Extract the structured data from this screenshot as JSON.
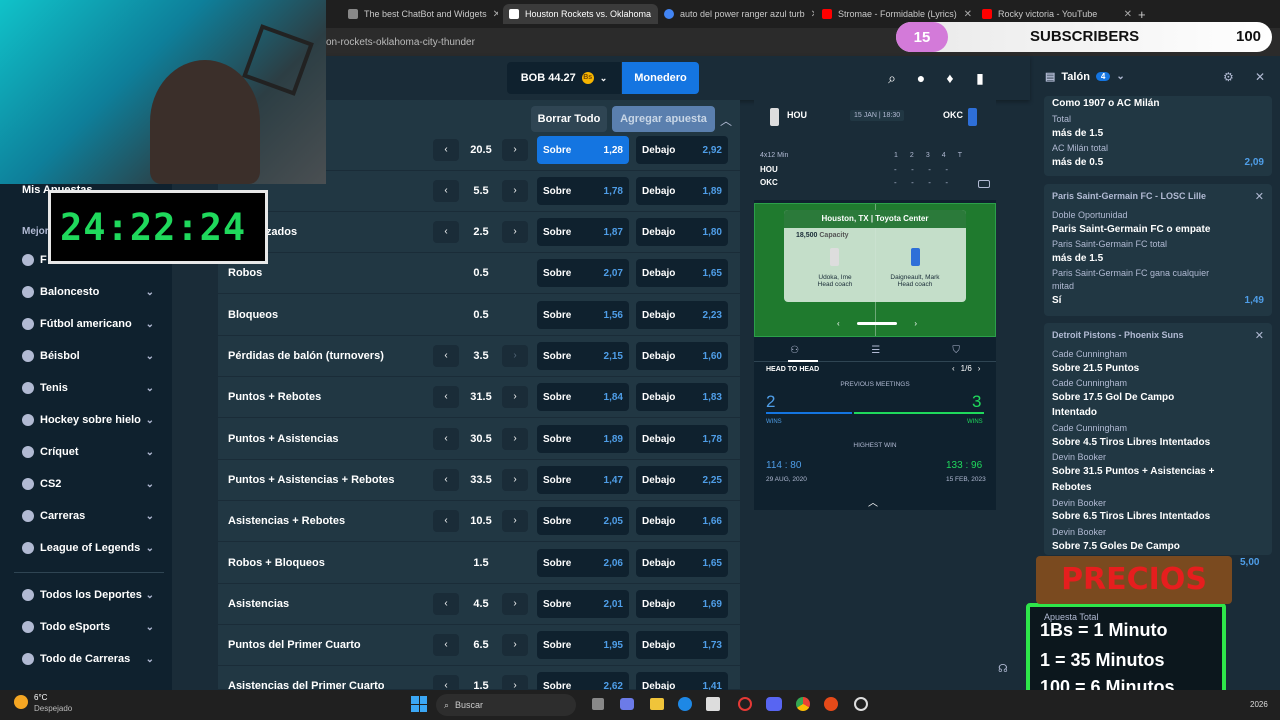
{
  "browser": {
    "tabs": [
      {
        "label": "The best ChatBot and Widgets"
      },
      {
        "label": "Houston Rockets vs. Oklahoma"
      },
      {
        "label": "auto del power ranger azul turb"
      },
      {
        "label": "Stromae - Formidable (Lyrics)"
      },
      {
        "label": "Rocky victoria - YouTube"
      }
    ],
    "url": "on-rockets-oklahoma-city-thunder"
  },
  "header": {
    "balance": "BOB 44.27",
    "wallet_label": "Monedero"
  },
  "sidebar": {
    "my_bets": "Mis Apuestas",
    "best_label": "Mejores D",
    "items": [
      {
        "label": "F"
      },
      {
        "label": "Baloncesto"
      },
      {
        "label": "Fútbol americano"
      },
      {
        "label": "Béisbol"
      },
      {
        "label": "Tenis"
      },
      {
        "label": "Hockey sobre hielo"
      },
      {
        "label": "Críquet"
      },
      {
        "label": "CS2"
      },
      {
        "label": "Carreras"
      },
      {
        "label": "League of Legends"
      },
      {
        "label": "Todos los Deportes"
      },
      {
        "label": "Todo eSports"
      },
      {
        "label": "Todo de Carreras"
      }
    ]
  },
  "betactions": {
    "clear": "Borrar Todo",
    "add": "Agregar apuesta"
  },
  "markets": [
    {
      "label": "",
      "line": "20.5",
      "over": "1,28",
      "under": "2,92",
      "arrows": true
    },
    {
      "label": "",
      "line": "5.5",
      "over": "1,78",
      "under": "1,89",
      "arrows": true
    },
    {
      "label": "es realizados",
      "line": "2.5",
      "over": "1,87",
      "under": "1,80",
      "arrows": true
    },
    {
      "label": "Robos",
      "line": "0.5",
      "over": "2,07",
      "under": "1,65",
      "arrows": false
    },
    {
      "label": "Bloqueos",
      "line": "0.5",
      "over": "1,56",
      "under": "2,23",
      "arrows": false
    },
    {
      "label": "Pérdidas de balón (turnovers)",
      "line": "3.5",
      "over": "2,15",
      "under": "1,60",
      "arrows": true
    },
    {
      "label": "Puntos + Rebotes",
      "line": "31.5",
      "over": "1,84",
      "under": "1,83",
      "arrows": true
    },
    {
      "label": "Puntos + Asistencias",
      "line": "30.5",
      "over": "1,89",
      "under": "1,78",
      "arrows": true
    },
    {
      "label": "Puntos + Asistencias + Rebotes",
      "line": "33.5",
      "over": "1,47",
      "under": "2,25",
      "arrows": true
    },
    {
      "label": "Asistencias + Rebotes",
      "line": "10.5",
      "over": "2,05",
      "under": "1,66",
      "arrows": true
    },
    {
      "label": "Robos + Bloqueos",
      "line": "1.5",
      "over": "2,06",
      "under": "1,65",
      "arrows": false
    },
    {
      "label": "Asistencias",
      "line": "4.5",
      "over": "2,01",
      "under": "1,69",
      "arrows": true
    },
    {
      "label": "Puntos del Primer Cuarto",
      "line": "6.5",
      "over": "1,95",
      "under": "1,73",
      "arrows": true
    },
    {
      "label": "Asistencias del Primer Cuarto",
      "line": "1.5",
      "over": "2,62",
      "under": "1,41",
      "arrows": true
    }
  ],
  "odds_labels": {
    "over": "Sobre",
    "under": "Debajo"
  },
  "match": {
    "home": "HOU",
    "away": "OKC",
    "date": "15 JAN | 18:30",
    "period_label": "4x12 Min",
    "periods": [
      "1",
      "2",
      "3",
      "4",
      "T"
    ],
    "dash": "-",
    "venue_city": "Houston, TX",
    "venue_name": "Toyota Center",
    "capacity_num": "18,500",
    "capacity_label": "Capacity",
    "coach_home": "Udoka, Ime",
    "coach_away": "Daigneault, Mark",
    "coach_label": "Head coach",
    "h2h_title": "HEAD TO HEAD",
    "h2h_page": "1/6",
    "prev_meetings": "PREVIOUS MEETINGS",
    "wins_home": "2",
    "wins_away": "3",
    "wins_label": "WINS",
    "highest_win": "HIGHEST WIN",
    "hw_home_score": "114 : 80",
    "hw_home_date": "29 AUG, 2020",
    "hw_away_score": "133 : 96",
    "hw_away_date": "15 FEB, 2023"
  },
  "betslip": {
    "title": "Talón",
    "count": "4",
    "card0": {
      "line1": "Como 1907 o AC Milán",
      "line2": "Total",
      "line3": "más de 1.5",
      "line4": "AC Milán total",
      "line5": "más de 0.5",
      "odds": "2,09"
    },
    "card1": {
      "title": "Paris Saint-Germain FC - LOSC Lille",
      "m1": "Doble Oportunidad",
      "s1": "Paris Saint-Germain FC o empate",
      "m2": "Paris Saint-Germain FC total",
      "s2": "más de 1.5",
      "m3": "Paris Saint-Germain FC gana cualquier",
      "m3b": "mitad",
      "s3": "Sí",
      "odds": "1,49"
    },
    "card2": {
      "title": "Detroit Pistons - Phoenix Suns",
      "m1": "Cade Cunningham",
      "s1": "Sobre 21.5 Puntos",
      "m2": "Cade Cunningham",
      "s2": "Sobre 17.5 Gol De Campo",
      "s2b": "Intentado",
      "m3": "Cade Cunningham",
      "s3": "Sobre 4.5 Tiros Libres Intentados",
      "m4": "Devin Booker",
      "s4": "Sobre 31.5 Puntos + Asistencias +",
      "s4b": "Rebotes",
      "m5": "Devin Booker",
      "s5": "Sobre 6.5 Tiros Libres Intentados",
      "m6": "Devin Booker",
      "s6": "Sobre 7.5 Goles De Campo",
      "odds": "5,00"
    },
    "total_label": "Apuesta Total"
  },
  "overlay": {
    "timer": "24:22:24",
    "subs_current": "15",
    "subs_label": "SUBSCRIBERS",
    "subs_goal": "100",
    "precios": "PRECIOS",
    "price1": "1Bs = 1 Minuto",
    "price2": "1 = 35 Minutos",
    "price3": "100 = 6 Minutos"
  },
  "taskbar": {
    "temp": "6°C",
    "weather": "Despejado",
    "search": "Buscar",
    "year": "2026"
  }
}
